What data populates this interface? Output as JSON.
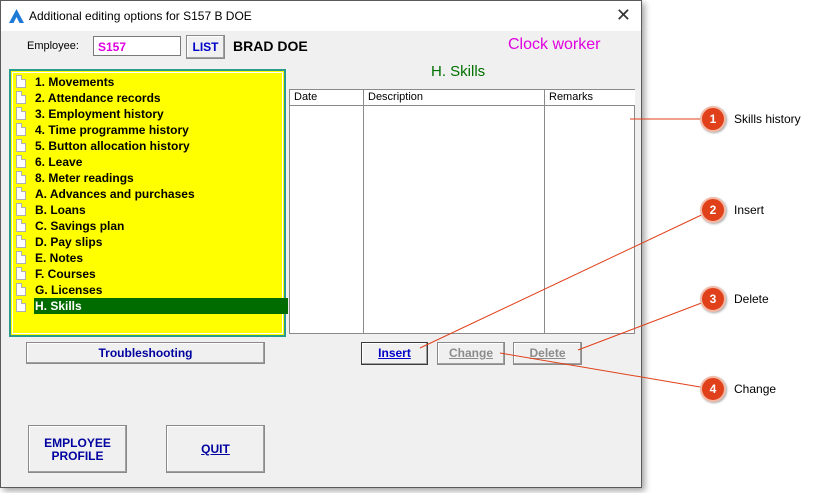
{
  "window": {
    "title": "Additional editing options for S157 B DOE",
    "close_symbol": "✕"
  },
  "employee": {
    "label": "Employee:",
    "code": "S157",
    "list_button": "LIST",
    "name": "BRAD DOE",
    "worker_type": "Clock worker"
  },
  "section_title": "H. Skills",
  "tree": {
    "items": [
      {
        "label": "1. Movements"
      },
      {
        "label": "2. Attendance records"
      },
      {
        "label": "3. Employment history"
      },
      {
        "label": "4. Time programme history"
      },
      {
        "label": "5. Button allocation history"
      },
      {
        "label": "6. Leave"
      },
      {
        "label": "8. Meter readings"
      },
      {
        "label": "A. Advances and purchases"
      },
      {
        "label": "B. Loans"
      },
      {
        "label": "C. Savings plan"
      },
      {
        "label": "D. Pay slips"
      },
      {
        "label": "E. Notes"
      },
      {
        "label": "F. Courses"
      },
      {
        "label": "G. Licenses"
      },
      {
        "label": "H. Skills",
        "selected": true
      }
    ]
  },
  "grid": {
    "columns": [
      "Date",
      "Description",
      "Remarks"
    ],
    "rows": []
  },
  "buttons": {
    "troubleshooting": "Troubleshooting",
    "insert": "Insert",
    "change": "Change",
    "delete": "Delete",
    "employee_profile_line1": "EMPLOYEE",
    "employee_profile_line2": "PROFILE",
    "quit": "QUIT"
  },
  "callouts": [
    {
      "number": "1",
      "label": "Skills history"
    },
    {
      "number": "2",
      "label": "Insert"
    },
    {
      "number": "3",
      "label": "Delete"
    },
    {
      "number": "4",
      "label": "Change"
    }
  ],
  "colors": {
    "tree_background": "#ffff00",
    "tree_selected": "#006c00",
    "accent_magenta": "#e000e0",
    "section_green": "#007000",
    "button_text": "#0000a0",
    "callout": "#e0401a"
  }
}
